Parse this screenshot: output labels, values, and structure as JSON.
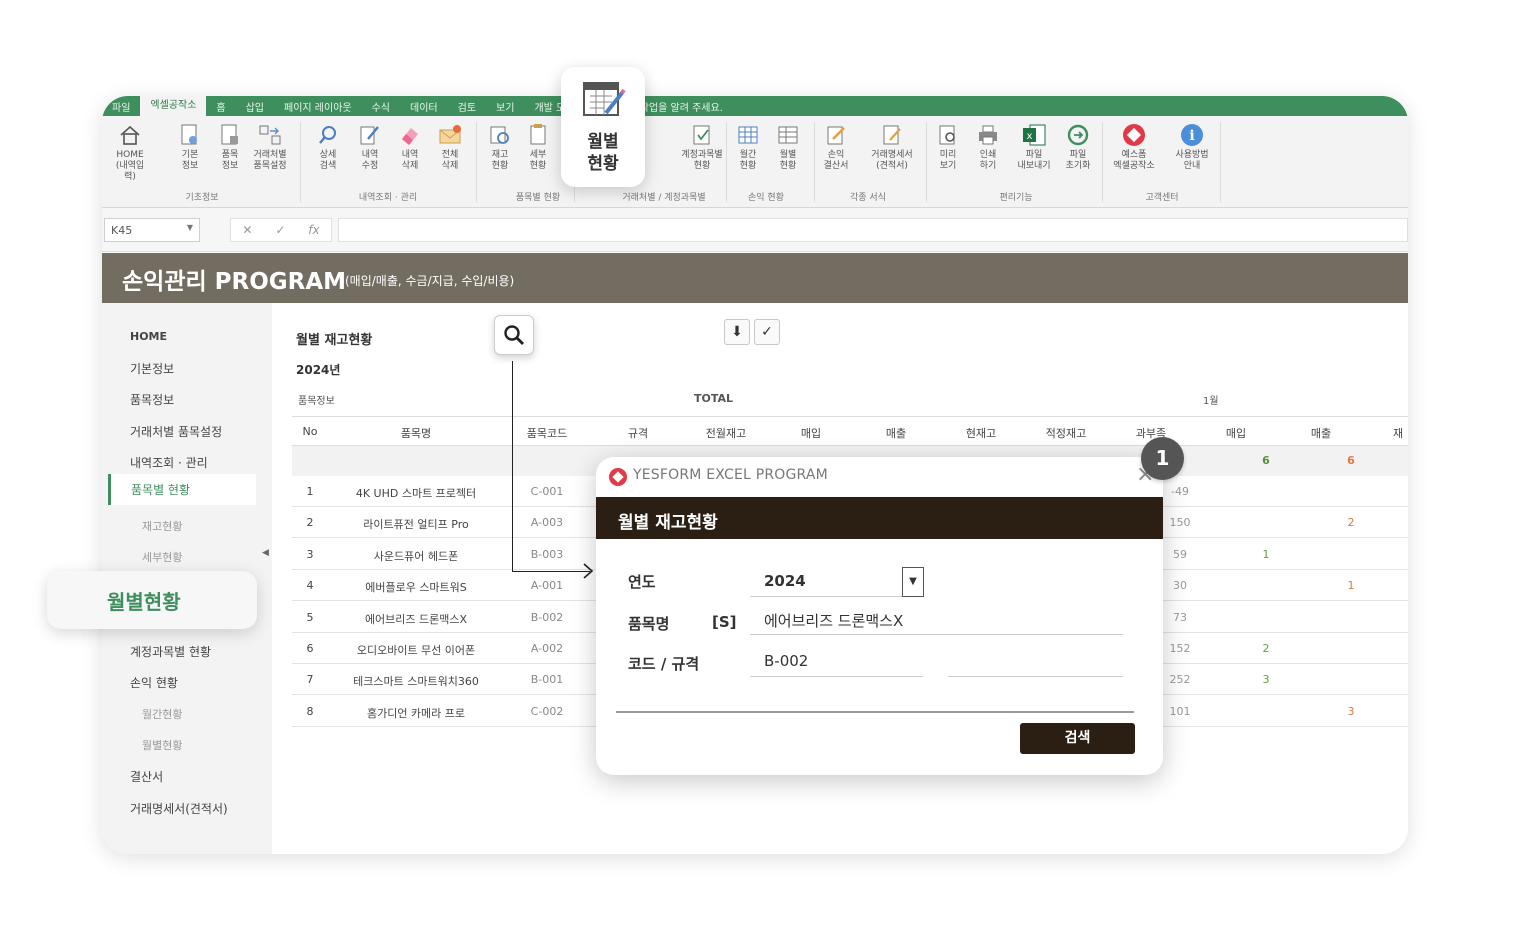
{
  "ribbon": {
    "tabs": [
      "파일",
      "엑셀공작소",
      "홈",
      "삽입",
      "페이지 레이아웃",
      "수식",
      "데이터",
      "검토",
      "보기",
      "개발 도구"
    ],
    "active_tab": "엑셀공작소",
    "tell_me": "수행할 작업을 알려 주세요.",
    "buttons": [
      {
        "label": "HOME\n(내역입력)",
        "icon": "home-icon"
      },
      {
        "label": "기본\n정보",
        "icon": "info-doc-icon"
      },
      {
        "label": "품목\n정보",
        "icon": "item-doc-icon"
      },
      {
        "label": "거래처별\n품목설정",
        "icon": "exchange-icon"
      },
      {
        "label": "상세\n검색",
        "icon": "search-icon"
      },
      {
        "label": "내역\n수정",
        "icon": "edit-icon"
      },
      {
        "label": "내역\n삭제",
        "icon": "eraser-icon"
      },
      {
        "label": "전체\n삭제",
        "icon": "envelope-delete-icon"
      },
      {
        "label": "재고\n현황",
        "icon": "stock-icon"
      },
      {
        "label": "세부\n현황",
        "icon": "detail-icon"
      },
      {
        "label": "계정과목별\n현황",
        "icon": "account-icon"
      },
      {
        "label": "월간\n현황",
        "icon": "calendar-grid-icon"
      },
      {
        "label": "월별\n현황",
        "icon": "table-icon"
      },
      {
        "label": "손익\n결산서",
        "icon": "report-icon"
      },
      {
        "label": "거래명세서\n(견적서)",
        "icon": "invoice-icon"
      },
      {
        "label": "미리\n보기",
        "icon": "preview-icon"
      },
      {
        "label": "인쇄\n하기",
        "icon": "print-icon"
      },
      {
        "label": "파일\n내보내기",
        "icon": "excel-icon"
      },
      {
        "label": "파일\n초기화",
        "icon": "refresh-icon"
      },
      {
        "label": "예스폼\n엑셀공작소",
        "icon": "yesform-icon"
      },
      {
        "label": "사용방법\n안내",
        "icon": "help-icon"
      }
    ],
    "groups": [
      "기초정보",
      "내역조회 · 관리",
      "품목별 현황",
      "거래처별 / 계정과목별",
      "손익 현황",
      "각종 서식",
      "편리기능",
      "고객센터"
    ]
  },
  "formula_bar": {
    "name_box": "K45",
    "fx": "fx"
  },
  "app": {
    "title": "손익관리 PROGRAM",
    "subtitle": "(매입/매출, 수금/지급, 수입/비용)"
  },
  "sidebar": {
    "items": [
      {
        "label": "HOME"
      },
      {
        "label": "기본정보"
      },
      {
        "label": "품목정보"
      },
      {
        "label": "거래처별 품목설정"
      },
      {
        "label": "내역조회 · 관리"
      },
      {
        "label": "품목별 현황"
      },
      {
        "label": "재고현황"
      },
      {
        "label": "세부현황"
      },
      {
        "label": "계정과목별 현황"
      },
      {
        "label": "손익 현황"
      },
      {
        "label": "월간현황"
      },
      {
        "label": "월별현황"
      },
      {
        "label": "결산서"
      },
      {
        "label": "거래명세서(견적서)"
      }
    ]
  },
  "sheet": {
    "title": "월별 재고현황",
    "year": "2024년",
    "section_info": "품목정보",
    "section_total": "TOTAL",
    "section_month": "1월",
    "headers": [
      "No",
      "품목명",
      "품목코드",
      "규격",
      "전월재고",
      "매입",
      "매출",
      "현재고",
      "적정재고",
      "과부족",
      "매입",
      "매출",
      "재"
    ],
    "total_row": {
      "buy": "6",
      "sell": "6"
    },
    "rows": [
      {
        "no": "1",
        "name": "4K UHD 스마트 프로젝터",
        "code": "C-001",
        "lack": "-49",
        "buy": "",
        "sell": ""
      },
      {
        "no": "2",
        "name": "라이트퓨전 얼티프 Pro",
        "code": "A-003",
        "lack": "150",
        "buy": "",
        "sell": "2"
      },
      {
        "no": "3",
        "name": "사운드퓨어 헤드폰",
        "code": "B-003",
        "lack": "59",
        "buy": "1",
        "sell": ""
      },
      {
        "no": "4",
        "name": "에버플로우 스마트워S",
        "code": "A-001",
        "lack": "30",
        "buy": "",
        "sell": "1"
      },
      {
        "no": "5",
        "name": "에어브리즈 드론맥스X",
        "code": "B-002",
        "lack": "73",
        "buy": "",
        "sell": ""
      },
      {
        "no": "6",
        "name": "오디오바이트 무선 이어폰",
        "code": "A-002",
        "lack": "152",
        "buy": "2",
        "sell": ""
      },
      {
        "no": "7",
        "name": "테크스마트 스마트워치360",
        "code": "B-001",
        "lack": "252",
        "buy": "3",
        "sell": ""
      },
      {
        "no": "8",
        "name": "홈가디언 카메라 프로",
        "code": "C-002",
        "lack": "101",
        "buy": "",
        "sell": "3"
      }
    ]
  },
  "callouts": {
    "top_label": "월별\n현황",
    "left_label": "월별현황",
    "badge": "1"
  },
  "dialog": {
    "app_name": "YESFORM EXCEL PROGRAM",
    "title": "월별 재고현황",
    "year_label": "연도",
    "year_value": "2024",
    "name_label": "품목명",
    "name_tag": "[S]",
    "name_value": "에어브리즈 드론맥스X",
    "code_label": "코드 / 규격",
    "code_value": "B-002",
    "spec_value": "",
    "search_button": "검색",
    "close": "×"
  },
  "colors": {
    "accent_green": "#3e8f5d",
    "title_band": "#736c60",
    "dialog_bar": "#2a1f12",
    "buy": "#6b9e3c",
    "sell": "#e07a3a"
  }
}
